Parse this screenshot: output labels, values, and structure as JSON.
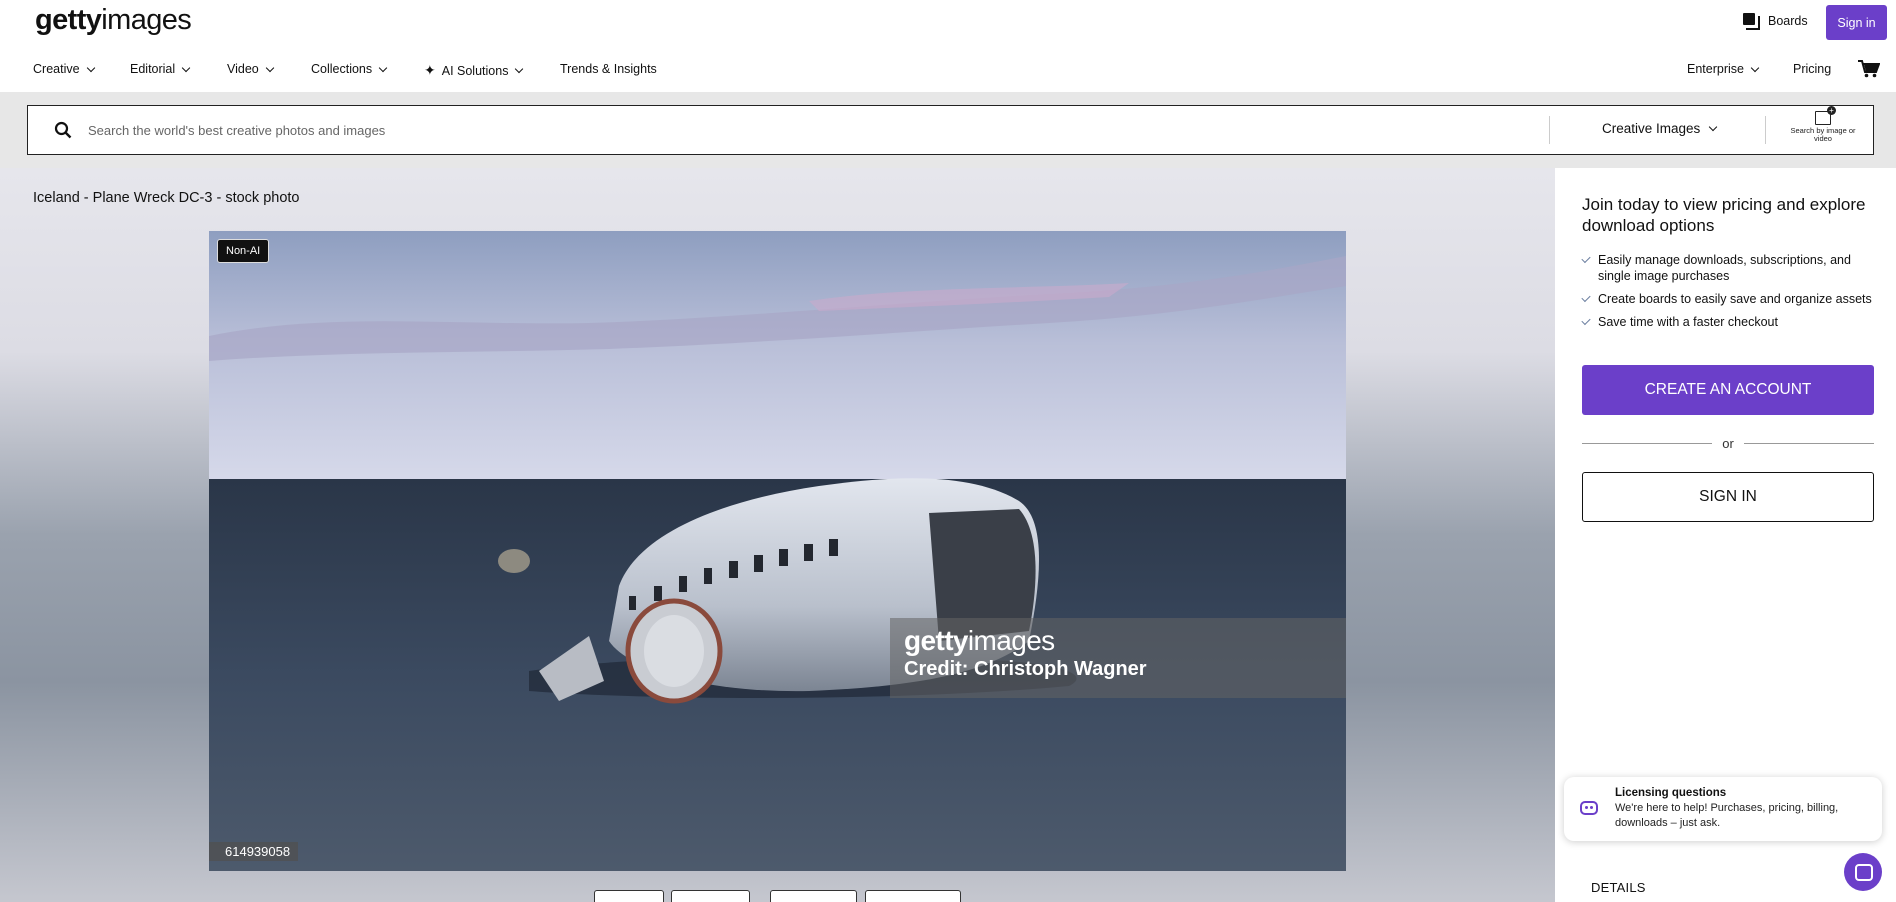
{
  "header": {
    "logo_bold": "getty",
    "logo_light": "images",
    "boards_label": "Boards",
    "signin_label": "Sign in"
  },
  "nav": {
    "items": [
      {
        "label": "Creative"
      },
      {
        "label": "Editorial"
      },
      {
        "label": "Video"
      },
      {
        "label": "Collections"
      },
      {
        "label": "AI Solutions"
      },
      {
        "label": "Trends & Insights"
      },
      {
        "label": "Enterprise"
      },
      {
        "label": "Pricing"
      }
    ]
  },
  "search": {
    "placeholder": "Search the world's best creative photos and images",
    "type_selected": "Creative Images",
    "search_by_image_label": "Search by image or video"
  },
  "asset": {
    "title": "Iceland - Plane Wreck DC-3 - stock photo",
    "badge": "Non-AI",
    "watermark_logo_bold": "getty",
    "watermark_logo_light": "images",
    "credit": "Credit: Christoph Wagner",
    "image_id": "614939058"
  },
  "panel": {
    "join_title": "Join today to view pricing and explore download options",
    "benefits": [
      "Easily manage downloads, subscriptions, and single image purchases",
      "Create boards to easily save and organize assets",
      "Save time with a faster checkout"
    ],
    "create_account_label": "CREATE AN ACCOUNT",
    "or_label": "or",
    "signin_label": "SIGN IN",
    "chat": {
      "title": "Licensing questions",
      "text": "We're here to help! Purchases, pricing, billing, downloads – just ask."
    },
    "details_label": "DETAILS"
  },
  "colors": {
    "accent": "#6b3fc9",
    "search_band": "#e7e7e7"
  }
}
